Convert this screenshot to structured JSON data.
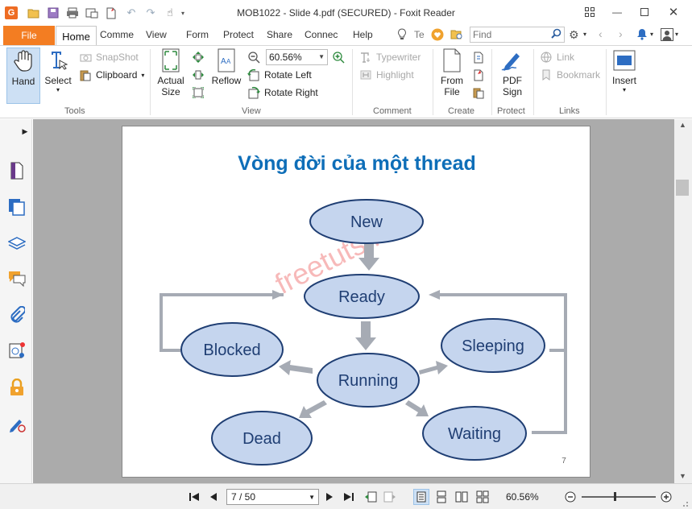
{
  "window": {
    "title": "MOB1022 - Slide 4.pdf (SECURED) - Foxit Reader",
    "app_logo": "G"
  },
  "menu": {
    "file": "File",
    "home": "Home",
    "items": [
      "Comme",
      "View",
      "Form",
      "Protect",
      "Share",
      "Connec",
      "Help"
    ],
    "tell_me": "Te",
    "find_placeholder": "Find"
  },
  "ribbon": {
    "tools": {
      "hand": "Hand",
      "select": "Select",
      "snapshot": "SnapShot",
      "clipboard": "Clipboard",
      "group_label": "Tools"
    },
    "view": {
      "actual_size": "Actual Size",
      "reflow": "Reflow",
      "zoom_value": "60.56%",
      "rotate_left": "Rotate Left",
      "rotate_right": "Rotate Right",
      "group_label": "View"
    },
    "comment": {
      "typewriter": "Typewriter",
      "highlight": "Highlight",
      "group_label": "Comment"
    },
    "create": {
      "from_file": "From File",
      "group_label": "Create"
    },
    "protect": {
      "pdf_sign": "PDF Sign",
      "group_label": "Protect"
    },
    "links": {
      "link": "Link",
      "bookmark": "Bookmark",
      "group_label": "Links"
    },
    "insert": {
      "insert": "Insert"
    }
  },
  "slide": {
    "title": "Vòng đời của một thread",
    "page_number": "7",
    "watermark": "freetuts.net",
    "states": {
      "new": "New",
      "ready": "Ready",
      "running": "Running",
      "blocked": "Blocked",
      "sleeping": "Sleeping",
      "dead": "Dead",
      "waiting": "Waiting"
    }
  },
  "status": {
    "page_indicator": "7 / 50",
    "zoom": "60.56%"
  },
  "colors": {
    "accent": "#f37d22",
    "title_blue": "#0e6eb8",
    "node_fill": "#c5d5ee",
    "node_stroke": "#1f3e73",
    "arrow": "#a6abb4"
  }
}
